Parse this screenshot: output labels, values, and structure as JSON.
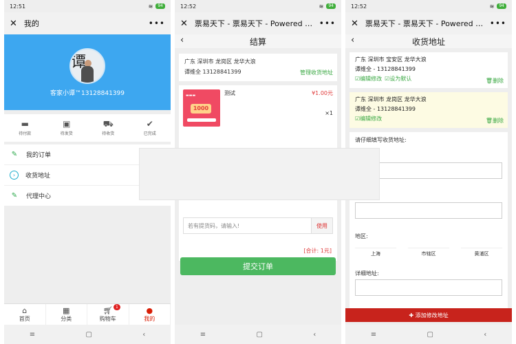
{
  "phone1": {
    "time": "12:51",
    "battery": "94",
    "title": "我的",
    "profile_name": "客家小谭™13128841399",
    "orders": [
      {
        "label": "待付款",
        "icon": "card-icon"
      },
      {
        "label": "待发货",
        "icon": "box-icon"
      },
      {
        "label": "待收货",
        "icon": "truck-icon"
      },
      {
        "label": "已完成",
        "icon": "check-icon"
      }
    ],
    "menu": [
      {
        "label": "我的订单",
        "icon": "edit-icon"
      },
      {
        "label": "收货地址",
        "icon": "arrow-circle-icon"
      },
      {
        "label": "代理中心",
        "icon": "edit-icon"
      }
    ],
    "tabs": [
      {
        "label": "首页",
        "icon": "home-icon"
      },
      {
        "label": "分类",
        "icon": "grid-icon"
      },
      {
        "label": "购物车",
        "icon": "cart-icon",
        "badge": "1"
      },
      {
        "label": "我的",
        "icon": "user-icon"
      }
    ]
  },
  "phone2": {
    "time": "12:52",
    "battery": "94",
    "title": "票易天下 - 票易天下 - Powered by...",
    "subtitle": "结算",
    "address_line1": "广东 深圳市 龙岗区 龙华大浪",
    "address_line2": "谭维全 13128841399",
    "manage_label": "管理收货地址",
    "product_name": "测试",
    "product_price": "¥1.00元",
    "product_qty": "×1",
    "product_img_text": "1000",
    "code_placeholder": "若有提货码，请输入!",
    "use_label": "使用",
    "total": "[合计: 1元]",
    "submit_label": "提交订单"
  },
  "phone3": {
    "time": "12:52",
    "battery": "94",
    "title": "票易天下 - 票易天下 - Powered by...",
    "subtitle": "收货地址",
    "addr1_line1": "广东 深圳市 宝安区 龙华大浪",
    "addr1_line2": "谭维全 - 13128841399",
    "addr1_edit": "编辑修改",
    "addr1_default": "设为默认",
    "addr1_delete": "删除",
    "addr2_line1": "广东 深圳市 龙岗区 龙华大浪",
    "addr2_line2": "谭维全 - 13128841399",
    "addr2_edit": "编辑修改",
    "addr2_delete": "删除",
    "form_title": "请仔细填写收货地址:",
    "region_label": "地区:",
    "region": [
      "上海",
      "市辖区",
      "黄浦区"
    ],
    "detail_label": "详细地址:",
    "add_button": "添加修改地址"
  }
}
